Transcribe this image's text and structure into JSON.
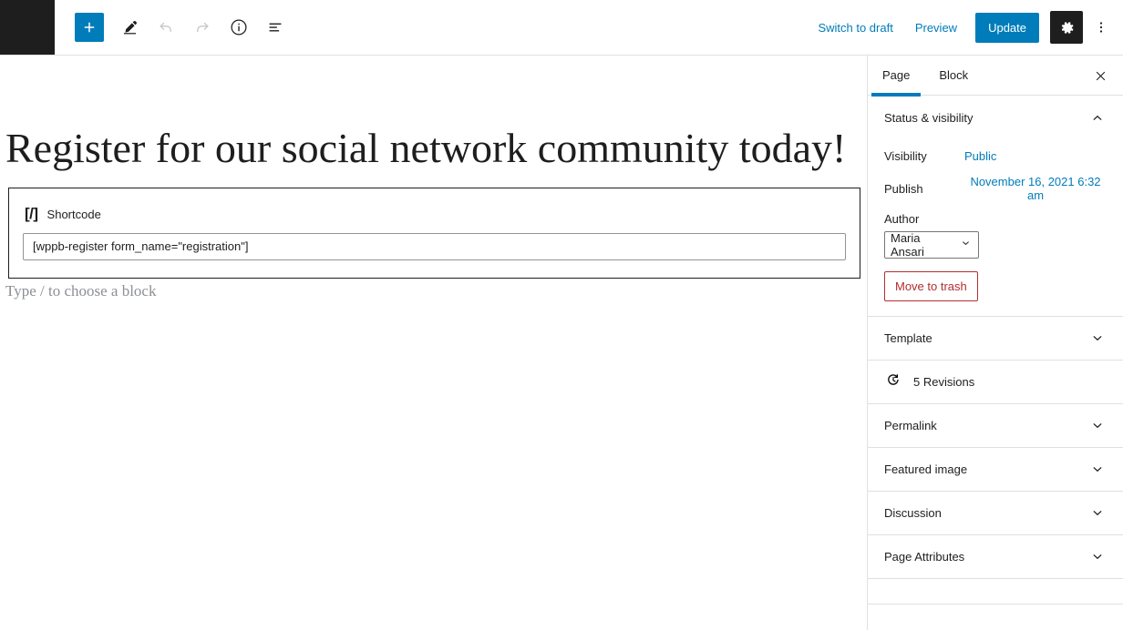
{
  "toolbar": {
    "logo_icon": "wordpress-logo-icon",
    "add_block_label": "+",
    "add_block_icon": "plus-icon",
    "tools_icon": "pencil-icon",
    "undo_icon": "undo-icon",
    "redo_icon": "redo-icon",
    "info_icon": "info-icon",
    "list_view_icon": "list-view-icon",
    "switch_to_draft_label": "Switch to draft",
    "preview_label": "Preview",
    "update_label": "Update",
    "settings_icon": "gear-icon",
    "more_options_icon": "kebab-menu-icon",
    "accent_blue": "#007cba",
    "dark": "#1e1e1e"
  },
  "editor": {
    "post_title": "Register for our social network community today!",
    "block": {
      "icon": "[/]",
      "icon_name": "shortcode-icon",
      "label": "Shortcode",
      "value": "[wppb-register form_name=\"registration\"]"
    },
    "append_placeholder": "Type / to choose a block"
  },
  "sidebar": {
    "tabs": [
      {
        "label": "Page",
        "active": true
      },
      {
        "label": "Block",
        "active": false
      }
    ],
    "close_icon": "close-icon",
    "panels": [
      {
        "title": "Status & visibility",
        "open": true,
        "chevron": "chevron-up-icon",
        "fields": {
          "visibility_label": "Visibility",
          "visibility_value": "Public",
          "publish_label": "Publish",
          "publish_value": "November 16, 2021 6:32 am",
          "author_label": "Author",
          "author_value": "Maria Ansari",
          "author_chevron": "chevron-down-icon",
          "trash_label": "Move to trash"
        }
      },
      {
        "title": "Template",
        "open": false,
        "chevron": "chevron-down-icon"
      },
      {
        "title": "Permalink",
        "open": false,
        "chevron": "chevron-down-icon"
      },
      {
        "title": "Featured image",
        "open": false,
        "chevron": "chevron-down-icon"
      },
      {
        "title": "Discussion",
        "open": false,
        "chevron": "chevron-down-icon"
      },
      {
        "title": "Page Attributes",
        "open": false,
        "chevron": "chevron-down-icon"
      }
    ],
    "revisions": {
      "icon": "revisions-clock-icon",
      "label": "5 Revisions"
    },
    "colors": {
      "link": "#007cba",
      "danger": "#b32d2e",
      "text": "#1e1e1e",
      "border": "#e0e0e0"
    }
  }
}
